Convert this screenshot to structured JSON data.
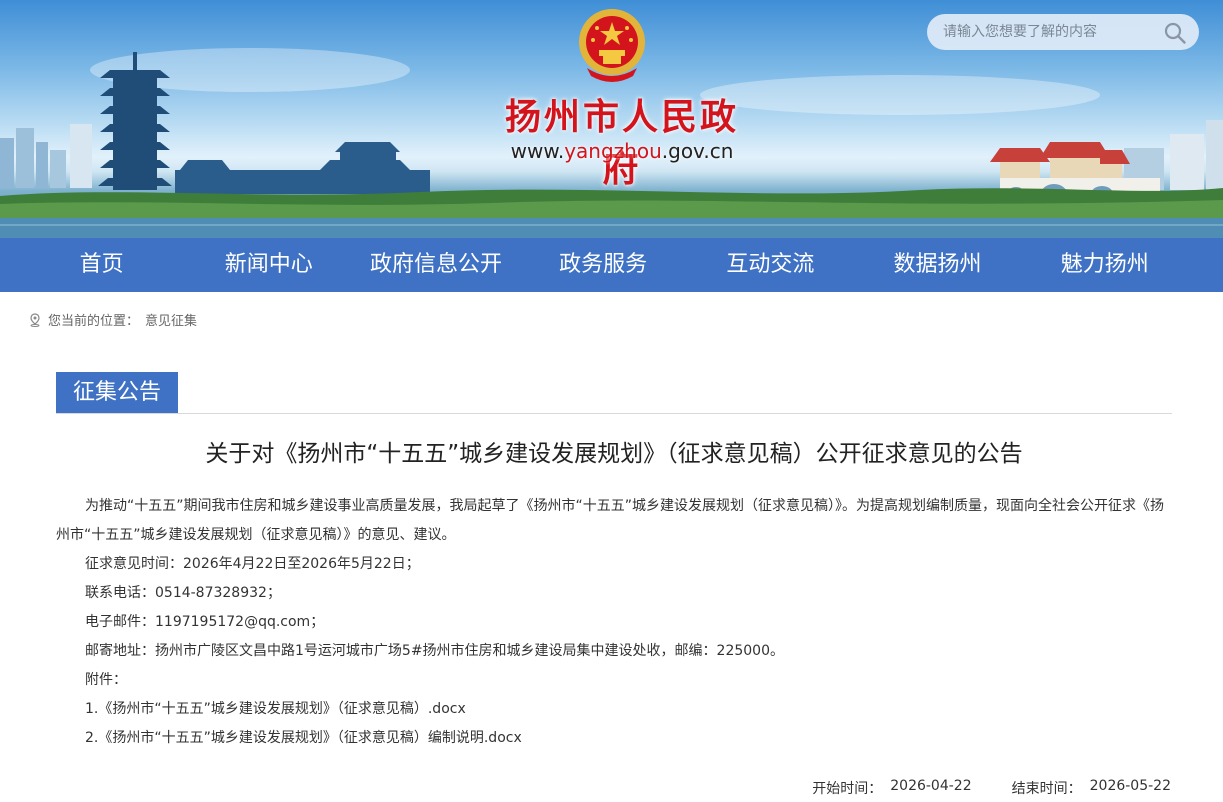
{
  "header": {
    "site_name": "扬州市人民政府",
    "url_prefix": "www.",
    "url_highlight": "yangzhou",
    "url_suffix": ".gov.cn",
    "search_placeholder": "请输入您想要了解的内容",
    "brand_red": "#d4141c",
    "nav_blue": "#3f72c4"
  },
  "nav": {
    "items": [
      "首页",
      "新闻中心",
      "政府信息公开",
      "政务服务",
      "互动交流",
      "数据扬州",
      "魅力扬州"
    ]
  },
  "breadcrumb": {
    "prefix": "您当前的位置：",
    "current": "意见征集"
  },
  "section": {
    "tab_label": "征集公告"
  },
  "article": {
    "title": "关于对《扬州市“十五五”城乡建设发展规划》（征求意见稿）公开征求意见的公告",
    "intro": "为推动“十五五”期间我市住房和城乡建设事业高质量发展，我局起草了《扬州市“十五五”城乡建设发展规划（征求意见稿）》。为提高规划编制质量，现面向全社会公开征求《扬州市“十五五”城乡建设发展规划（征求意见稿）》的意见、建议。",
    "period": "征求意见时间：2026年4月22日至2026年5月22日；",
    "phone": "联系电话：0514-87328932；",
    "email": "电子邮件：1197195172@qq.com；",
    "address": "邮寄地址：扬州市广陵区文昌中路1号运河城市广场5#扬州市住房和城乡建设局集中建设处收，邮编：225000。",
    "attachments_label": "附件：",
    "attachments": [
      "1.《扬州市“十五五”城乡建设发展规划》（征求意见稿）.docx",
      "2.《扬州市“十五五”城乡建设发展规划》（征求意见稿）编制说明.docx"
    ]
  },
  "dates": {
    "start_label": "开始时间：",
    "start": "2026-04-22",
    "end_label": "结束时间：",
    "end": "2026-05-22"
  }
}
